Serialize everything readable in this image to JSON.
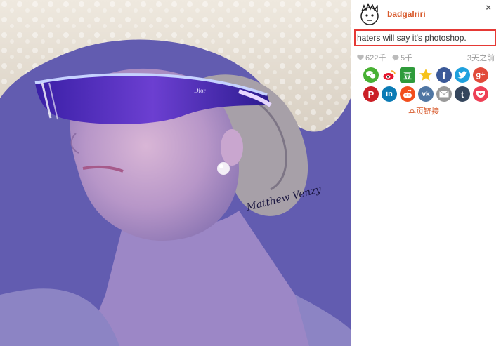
{
  "post": {
    "username": "badgalriri",
    "caption": "haters will say it's photoshop.",
    "close_label": "×",
    "likes": "622千",
    "comments": "5千",
    "time_ago": "3天之前",
    "permalink_label": "本页链接",
    "photo_watermark": "Matthew Venzy",
    "glasses_brand": "Dior"
  },
  "share": {
    "row1": [
      {
        "name": "wechat-share-icon",
        "color": "#48b134",
        "glyph": ""
      },
      {
        "name": "weibo-share-icon",
        "color": "#ffffff",
        "glyph": ""
      },
      {
        "name": "douban-share-icon",
        "color": "#2f9b3b",
        "glyph": "豆"
      },
      {
        "name": "qzone-share-icon",
        "color": "#ffffff",
        "glyph": ""
      },
      {
        "name": "facebook-share-icon",
        "color": "#3b5998",
        "glyph": "f"
      },
      {
        "name": "twitter-share-icon",
        "color": "#1ea1de",
        "glyph": ""
      },
      {
        "name": "googleplus-share-icon",
        "color": "#e14a3a",
        "glyph": "g+"
      }
    ],
    "row2": [
      {
        "name": "pinterest-share-icon",
        "color": "#cb2027",
        "glyph": "P"
      },
      {
        "name": "linkedin-share-icon",
        "color": "#0b7bb5",
        "glyph": "in"
      },
      {
        "name": "reddit-share-icon",
        "color": "#f24f1d",
        "glyph": ""
      },
      {
        "name": "vk-share-icon",
        "color": "#4f76a3",
        "glyph": "vk"
      },
      {
        "name": "email-share-icon",
        "color": "#9a9a9a",
        "glyph": ""
      },
      {
        "name": "tumblr-share-icon",
        "color": "#35465d",
        "glyph": "t"
      },
      {
        "name": "pocket-share-icon",
        "color": "#ee4056",
        "glyph": ""
      }
    ]
  }
}
